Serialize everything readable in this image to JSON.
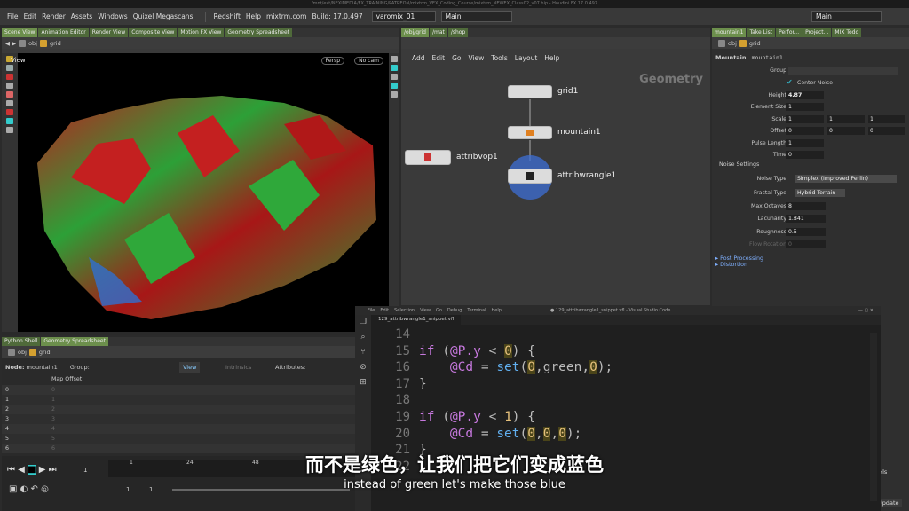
{
  "window": {
    "title": "/mnt/ext/NEXIMEDIA/FX_TRAINING/PATREON/mixtrm_VEX_Coding_Course/mixtrm_NEWEX_Class02_v07.hip - Houdini FX 17.0.497"
  },
  "menubar": {
    "items": [
      "File",
      "Edit",
      "Render",
      "Assets",
      "Windows",
      "Quixel Megascans"
    ],
    "redshift": "Redshift",
    "help": "Help",
    "site": "mixtrm.com",
    "build": "Build: 17.0.497",
    "desktop": "varomix_01",
    "main": "Main",
    "right_main": "Main"
  },
  "left_panel": {
    "tabs": [
      "Scene View",
      "Animation Editor",
      "Render View",
      "Composite View",
      "Motion FX View",
      "Geometry Spreadsheet"
    ],
    "path_obj": "obj",
    "path_node": "grid",
    "view_label": "View",
    "persp": "Persp",
    "cam": "No cam"
  },
  "network": {
    "tabs": [
      "/obj/grid",
      "/mat",
      "/shop"
    ],
    "menu": [
      "Add",
      "Edit",
      "Go",
      "View",
      "Tools",
      "Layout",
      "Help"
    ],
    "context": "Geometry",
    "nodes": {
      "grid": "grid1",
      "mountain": "mountain1",
      "attribvop": "attribvop1",
      "wrangle": "attribwrangle1"
    }
  },
  "params": {
    "tabs": [
      "mountain1",
      "Take List",
      "Perfor...",
      "Project...",
      "MIX Todo"
    ],
    "path_obj": "obj",
    "path_node": "grid",
    "node_type": "Mountain",
    "node_name": "mountain1",
    "group": "Group",
    "center_noise": "Center Noise",
    "rows": [
      {
        "label": "Height",
        "v": [
          "4.87"
        ]
      },
      {
        "label": "Element Size",
        "v": [
          "1"
        ]
      },
      {
        "label": "Scale",
        "v": [
          "1",
          "1",
          "1"
        ]
      },
      {
        "label": "Offset",
        "v": [
          "0",
          "0",
          "0"
        ]
      },
      {
        "label": "Pulse Length",
        "v": [
          "1"
        ]
      },
      {
        "label": "Time",
        "v": [
          "0"
        ]
      }
    ],
    "noise_settings": "Noise Settings",
    "noise_type_label": "Noise Type",
    "noise_type": "Simplex (Improved Perlin)",
    "fractal_label": "Fractal Type",
    "fractal": "Hybrid Terrain",
    "rows2": [
      {
        "label": "Max Octaves",
        "v": "8"
      },
      {
        "label": "Lacunarity",
        "v": "1.841"
      },
      {
        "label": "Roughness",
        "v": "0.5"
      },
      {
        "label": "Flow Rotation",
        "v": "0"
      }
    ],
    "post": "Post Processing",
    "distortion": "Distortion",
    "update": "Update",
    "panels": "nels"
  },
  "spreadsheet": {
    "tabs": [
      "Python Shell",
      "Geometry Spreadsheet"
    ],
    "path_obj": "obj",
    "path_node": "grid",
    "node_label": "Node:",
    "node": "mountain1",
    "group": "Group:",
    "view": "View",
    "intrinsics": "Intrinsics",
    "attributes": "Attributes:",
    "col": "Map Offset",
    "rows": [
      {
        "i": "0",
        "v": "0"
      },
      {
        "i": "1",
        "v": "1"
      },
      {
        "i": "2",
        "v": "2"
      },
      {
        "i": "3",
        "v": "3"
      },
      {
        "i": "4",
        "v": "4"
      },
      {
        "i": "5",
        "v": "5"
      },
      {
        "i": "6",
        "v": "6"
      }
    ]
  },
  "timeline": {
    "frame": "1",
    "ticks": [
      "1",
      "24",
      "48"
    ],
    "start": "1",
    "end": "1"
  },
  "vscode": {
    "menu": [
      "File",
      "Edit",
      "Selection",
      "View",
      "Go",
      "Debug",
      "Terminal",
      "Help"
    ],
    "title": "● 129_attribwrangle1_snippet.vfl - Visual Studio Code",
    "tab": "129_attribwrangle1_snippet.vfl",
    "lines": [
      {
        "n": "14",
        "c": []
      },
      {
        "n": "15",
        "c": [
          {
            "t": "if ",
            "k": "kw"
          },
          {
            "t": "(",
            "k": ""
          },
          {
            "t": "@P.y",
            "k": "at"
          },
          {
            "t": " < ",
            "k": ""
          },
          {
            "t": "0",
            "k": "hl0"
          },
          {
            "t": ") {",
            "k": ""
          }
        ]
      },
      {
        "n": "16",
        "c": [
          {
            "t": "    @Cd",
            "k": "at"
          },
          {
            "t": " = ",
            "k": ""
          },
          {
            "t": "set",
            "k": "fn"
          },
          {
            "t": "(",
            "k": ""
          },
          {
            "t": "0",
            "k": "hl0"
          },
          {
            "t": ",green,",
            "k": ""
          },
          {
            "t": "0",
            "k": "hl0"
          },
          {
            "t": ");",
            "k": ""
          }
        ]
      },
      {
        "n": "17",
        "c": [
          {
            "t": "}",
            "k": ""
          }
        ]
      },
      {
        "n": "18",
        "c": []
      },
      {
        "n": "19",
        "c": [
          {
            "t": "if ",
            "k": "kw"
          },
          {
            "t": "(",
            "k": ""
          },
          {
            "t": "@P.y",
            "k": "at"
          },
          {
            "t": " < ",
            "k": ""
          },
          {
            "t": "1",
            "k": "nm"
          },
          {
            "t": ") {",
            "k": ""
          }
        ]
      },
      {
        "n": "20",
        "c": [
          {
            "t": "    @Cd",
            "k": "at"
          },
          {
            "t": " = ",
            "k": ""
          },
          {
            "t": "set",
            "k": "fn"
          },
          {
            "t": "(",
            "k": ""
          },
          {
            "t": "0",
            "k": "hl0"
          },
          {
            "t": ",",
            "k": ""
          },
          {
            "t": "0",
            "k": "hl0"
          },
          {
            "t": ",",
            "k": ""
          },
          {
            "t": "0",
            "k": "hl0"
          },
          {
            "t": ");",
            "k": ""
          }
        ]
      },
      {
        "n": "21",
        "c": [
          {
            "t": "}",
            "k": ""
          }
        ]
      },
      {
        "n": "22",
        "c": []
      }
    ]
  },
  "subtitle": {
    "cn": "而不是绿色，让我们把它们变成蓝色",
    "en": "instead of green let's make those blue"
  },
  "colors": {
    "accent": "#6c8f4c",
    "terrain_red": "#c42020",
    "terrain_green": "#2fa83a",
    "wrangle_blue": "#2f6fd0"
  }
}
